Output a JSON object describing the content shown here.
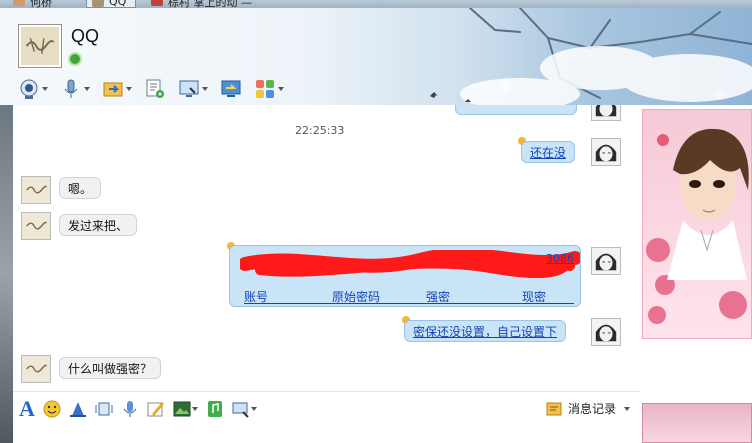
{
  "tabs": [
    {
      "label": "何桥"
    },
    {
      "label": "QQ"
    },
    {
      "label": "棕村 掌上的动 —"
    }
  ],
  "header": {
    "title": "QQ"
  },
  "toolbar": {
    "icons": [
      "webcam-icon",
      "microphone-icon",
      "send-file-icon",
      "sms-icon",
      "remote-assist-icon",
      "screen-share-icon",
      "apps-icon"
    ]
  },
  "chat": {
    "time": "22:25:33",
    "messages": [
      {
        "side": "right",
        "text": "还在没"
      },
      {
        "side": "left",
        "text": "嗯。"
      },
      {
        "side": "left",
        "text": "发过来把、"
      },
      {
        "side": "right",
        "type": "table",
        "number_tail": "3086",
        "columns": [
          "账号",
          "原始密码",
          "强密",
          "现密"
        ]
      },
      {
        "side": "right",
        "text": "密保还没设置，自己设置下"
      },
      {
        "side": "left",
        "text": "什么叫做强密？"
      }
    ]
  },
  "input_toolbar": {
    "icons": [
      "font-icon",
      "emoticon-icon",
      "magic-hat-icon",
      "shake-icon",
      "voice-message-icon",
      "handwriting-icon",
      "image-icon",
      "music-icon",
      "screenshot-icon"
    ],
    "history_label": "消息记录"
  },
  "colors": {
    "link_blue": "#1544b8",
    "bubble_right": "#c9e3f7",
    "bubble_left": "#f1f1f1",
    "redact_red": "#ff1a1a"
  }
}
